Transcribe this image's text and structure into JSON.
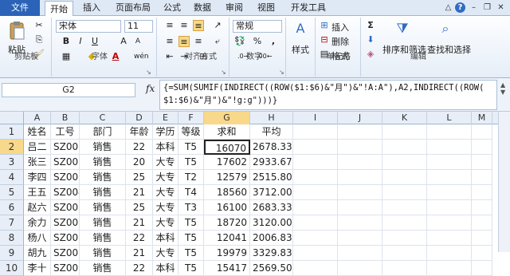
{
  "tabs": {
    "file": "文件",
    "items": [
      "开始",
      "插入",
      "页面布局",
      "公式",
      "数据",
      "审阅",
      "视图",
      "开发工具"
    ]
  },
  "ribbon": {
    "clipboard": {
      "paste": "粘贴",
      "label": "剪贴板"
    },
    "font": {
      "name": "宋体",
      "size": "11",
      "bold": "B",
      "italic": "I",
      "underline": "U",
      "grow": "A",
      "shrink": "A",
      "ab": "wén",
      "label": "字体"
    },
    "alignment": {
      "label": "对齐方式"
    },
    "number": {
      "format": "常规",
      "percent": "%",
      "comma": ",",
      "label": "数字"
    },
    "styles": {
      "style": "样式"
    },
    "cells": {
      "insert": "插入",
      "delete": "删除",
      "format": "格式",
      "label": "单元格"
    },
    "editing": {
      "sort": "排序和筛选",
      "find": "查找和选择",
      "label": "编辑",
      "sum": "Σ"
    }
  },
  "formula_bar": {
    "name_box": "G2",
    "fx": "fx",
    "formula_line1": "{=SUM(SUMIF(INDIRECT((ROW($1:$6)&\"月\")&\"!A:A\"),A2,INDIRECT((ROW(",
    "formula_line2": "$1:$6)&\"月\")&\"!g:g\")))}"
  },
  "columns": [
    "A",
    "B",
    "C",
    "D",
    "E",
    "F",
    "G",
    "H",
    "I",
    "J",
    "K",
    "L",
    "M"
  ],
  "selected": {
    "column": "G",
    "row": "2"
  },
  "rows": [
    {
      "n": "1",
      "cells": [
        "姓名",
        "工号",
        "部门",
        "年龄",
        "学历",
        "等级",
        "求和",
        "平均"
      ]
    },
    {
      "n": "2",
      "cells": [
        "吕二",
        "SZ001",
        "销售",
        "22",
        "本科",
        "T5",
        "16070",
        "2678.33"
      ]
    },
    {
      "n": "3",
      "cells": [
        "张三",
        "SZ002",
        "销售",
        "20",
        "大专",
        "T5",
        "17602",
        "2933.67"
      ]
    },
    {
      "n": "4",
      "cells": [
        "李四",
        "SZ003",
        "销售",
        "25",
        "大专",
        "T2",
        "12579",
        "2515.80"
      ]
    },
    {
      "n": "5",
      "cells": [
        "王五",
        "SZ004",
        "销售",
        "21",
        "大专",
        "T4",
        "18560",
        "3712.00"
      ]
    },
    {
      "n": "6",
      "cells": [
        "赵六",
        "SZ005",
        "销售",
        "25",
        "大专",
        "T3",
        "16100",
        "2683.33"
      ]
    },
    {
      "n": "7",
      "cells": [
        "余力",
        "SZ006",
        "销售",
        "21",
        "大专",
        "T5",
        "18720",
        "3120.00"
      ]
    },
    {
      "n": "8",
      "cells": [
        "杨八",
        "SZ007",
        "销售",
        "22",
        "本科",
        "T5",
        "12041",
        "2006.83"
      ]
    },
    {
      "n": "9",
      "cells": [
        "胡九",
        "SZ008",
        "销售",
        "21",
        "大专",
        "T5",
        "19979",
        "3329.83"
      ]
    },
    {
      "n": "10",
      "cells": [
        "李十",
        "SZ009",
        "销售",
        "22",
        "本科",
        "T5",
        "15417",
        "2569.50"
      ]
    }
  ]
}
